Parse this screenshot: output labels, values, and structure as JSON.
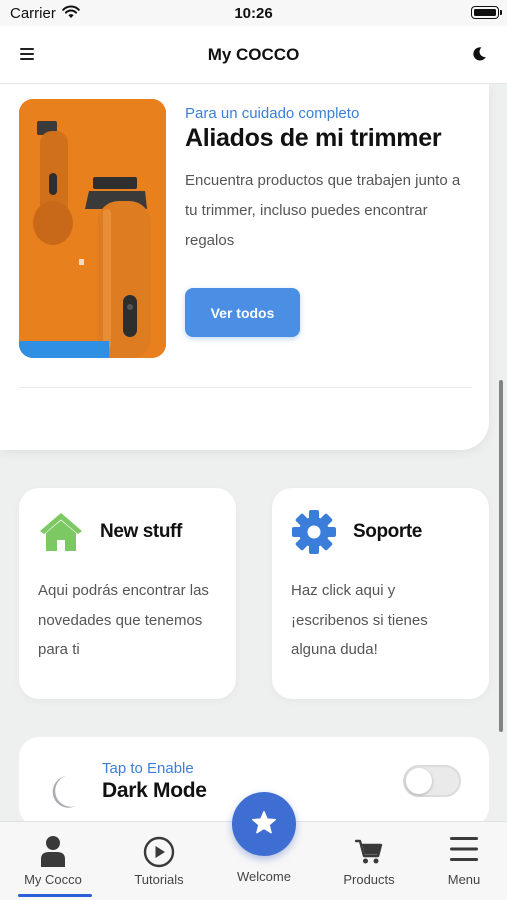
{
  "status_bar": {
    "carrier": "Carrier",
    "time": "10:26"
  },
  "header": {
    "title": "My COCCO",
    "menu_icon": "hamburger-icon",
    "theme_icon": "moon-icon"
  },
  "hero": {
    "eyebrow": "Para un cuidado completo",
    "title": "Aliados de mi trimmer",
    "description": "Encuentra productos que trabajen junto a tu trimmer, incluso puedes encontrar regalos",
    "button_label": "Ver todos",
    "image": "trimmer-products-image"
  },
  "features": [
    {
      "icon": "home-icon",
      "title": "New stuff",
      "description": "Aqui podrás encontrar las novedades que tenemos para ti"
    },
    {
      "icon": "gear-icon",
      "title": "Soporte",
      "description": "Haz click aqui y ¡escribenos si tienes alguna duda!"
    }
  ],
  "dark_mode": {
    "hint": "Tap to Enable",
    "title": "Dark Mode",
    "enabled": false
  },
  "tabs": [
    {
      "label": "My Cocco",
      "icon": "user-icon",
      "active": true
    },
    {
      "label": "Tutorials",
      "icon": "play-circle-icon",
      "active": false
    },
    {
      "label": "Welcome",
      "icon": "star-icon",
      "active": false
    },
    {
      "label": "Products",
      "icon": "cart-icon",
      "active": false
    },
    {
      "label": "Menu",
      "icon": "hamburger-icon",
      "active": false
    }
  ],
  "colors": {
    "accent_blue": "#3c7fd6",
    "button_blue": "#4a8fe4",
    "fab_blue": "#3f6ed3",
    "home_green": "#7cc862",
    "gear_blue": "#3a7ddb",
    "product_orange": "#e8801e"
  }
}
